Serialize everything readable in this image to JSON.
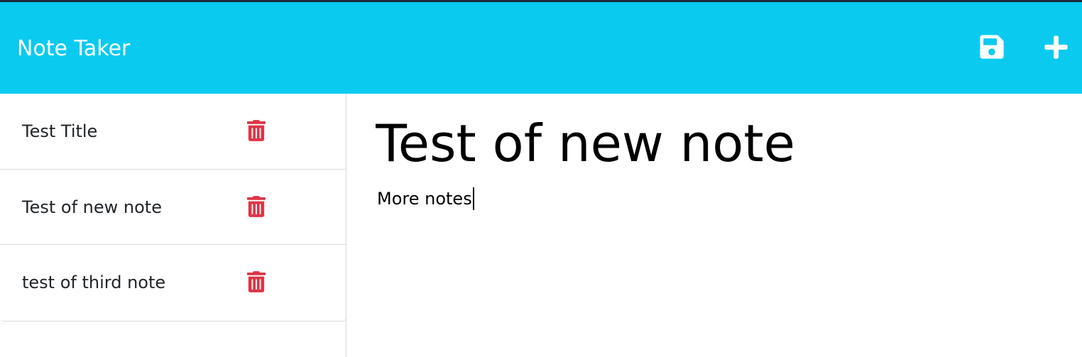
{
  "header": {
    "brand": "Note Taker",
    "save_icon": "save-icon",
    "new_icon": "plus-icon",
    "accent_color": "#0acaf0"
  },
  "notes": [
    {
      "title": "Test Title",
      "delete_icon": "trash-icon"
    },
    {
      "title": "Test of new note",
      "delete_icon": "trash-icon"
    },
    {
      "title": "test of third note",
      "delete_icon": "trash-icon"
    }
  ],
  "delete_color": "#dc3545",
  "editor": {
    "title_value": "Test of new note",
    "body_value": "More notes"
  }
}
